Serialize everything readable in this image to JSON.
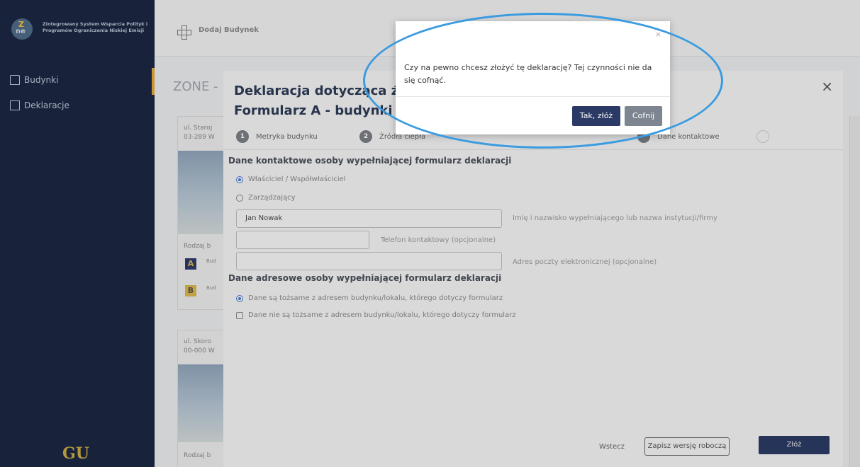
{
  "sidebar": {
    "app_title": "Zintegrowany System Wsparcia Polityk i Programów Ograniczenia Niskiej Emisji",
    "logo_z": "Z",
    "logo_ne": "ne",
    "items": [
      {
        "label": "Budynki",
        "icon": "building-icon"
      },
      {
        "label": "Deklaracje",
        "icon": "document-icon"
      }
    ],
    "footer_logo": "GU"
  },
  "topbar": {
    "add_building_label": "Dodaj Budynek"
  },
  "background": {
    "zone_title": "ZONE -",
    "card1": {
      "address_line1": "ul. Staroj",
      "address_line2": "03-289 W",
      "kind": "Rodzaj b",
      "badge_a": "A",
      "badge_b": "B",
      "row_a": "Bud",
      "row_b": "Bud"
    },
    "card2": {
      "address_line1": "ul. Skoro",
      "address_line2": "00-000 W",
      "kind": "Rodzaj b"
    }
  },
  "modal": {
    "title_line1": "Deklaracja dotycząca źr",
    "title_line2": "Formularz A - budynki i",
    "close": "×",
    "steps": [
      {
        "num": "1",
        "label": "Metryka budynku"
      },
      {
        "num": "2",
        "label": "Źródła ciepła"
      },
      {
        "num": "",
        "label": "Dane kontaktowe"
      }
    ],
    "section_contact": "Dane kontaktowe osoby wypełniającej formularz deklaracji",
    "radio_owner": "Właściciel / Współwłaściciel",
    "radio_manager": "Zarządzający",
    "name_value": "Jan Nowak",
    "name_label": "Imię i nazwisko wypełniającego lub nazwa instytucji/firmy",
    "phone_label": "Telefon kontaktowy (opcjonalne)",
    "email_label": "Adres poczty elektronicznej (opcjonalne)",
    "section_address": "Dane adresowe osoby wypełniającej formularz deklaracji",
    "radio_same": "Dane są tożsame z adresem budynku/lokalu, którego dotyczy formularz",
    "radio_not_same": "Dane nie są tożsame z adresem budynku/lokalu, którego dotyczy formularz",
    "back_label": "Wstecz",
    "draft_label": "Zapisz wersję roboczą",
    "submit_label": "Złóż"
  },
  "dialog": {
    "close": "×",
    "message": "Czy na pewno chcesz złożyć tę deklarację? Tej czynności nie da się cofnąć.",
    "confirm_label": "Tak, złóż",
    "cancel_label": "Cofnij"
  },
  "colors": {
    "sidebar_bg": "#1b2742",
    "accent": "#e2a83a",
    "primary_button": "#2b3a64",
    "annotation": "#3a9be0"
  }
}
